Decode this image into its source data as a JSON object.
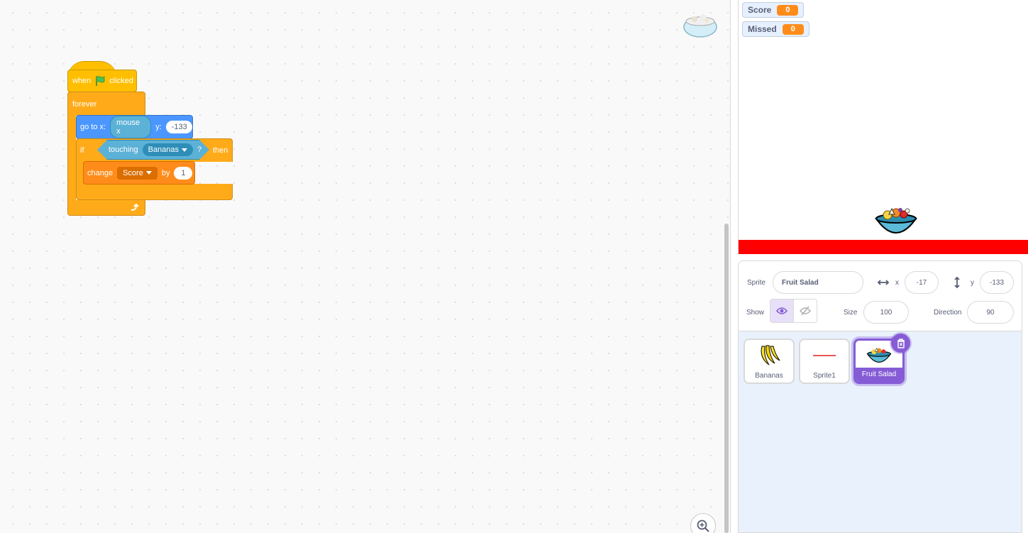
{
  "code": {
    "hat": {
      "when": "when",
      "clicked": "clicked"
    },
    "forever": {
      "label": "forever"
    },
    "goto": {
      "prefix": "go to x:",
      "x_reporter": "mouse x",
      "y_label": "y:",
      "y_value": "-133"
    },
    "if_block": {
      "if_label": "if",
      "touching": "touching",
      "target": "Bananas",
      "question": "?",
      "then": "then"
    },
    "change_block": {
      "change": "change",
      "variable": "Score",
      "by": "by",
      "amount": "1"
    }
  },
  "stage": {
    "monitors": [
      {
        "label": "Score",
        "value": "0"
      },
      {
        "label": "Missed",
        "value": "0"
      }
    ]
  },
  "sprite_info": {
    "sprite_label": "Sprite",
    "sprite_name": "Fruit Salad",
    "x_label": "x",
    "x_value": "-17",
    "y_label": "y",
    "y_value": "-133",
    "show_label": "Show",
    "size_label": "Size",
    "size_value": "100",
    "direction_label": "Direction",
    "direction_value": "90"
  },
  "sprites": [
    {
      "name": "Bananas",
      "icon": "bananas-icon"
    },
    {
      "name": "Sprite1",
      "icon": "red-line-icon"
    },
    {
      "name": "Fruit Salad",
      "icon": "fruit-bowl-icon",
      "selected": true
    }
  ],
  "colors": {
    "events": "#ffbf00",
    "control": "#ffab19",
    "motion": "#4c97ff",
    "sensing": "#5cb1d6",
    "variables": "#ff8c1a",
    "selection": "#855cd6",
    "stage_line": "#ff0000"
  }
}
